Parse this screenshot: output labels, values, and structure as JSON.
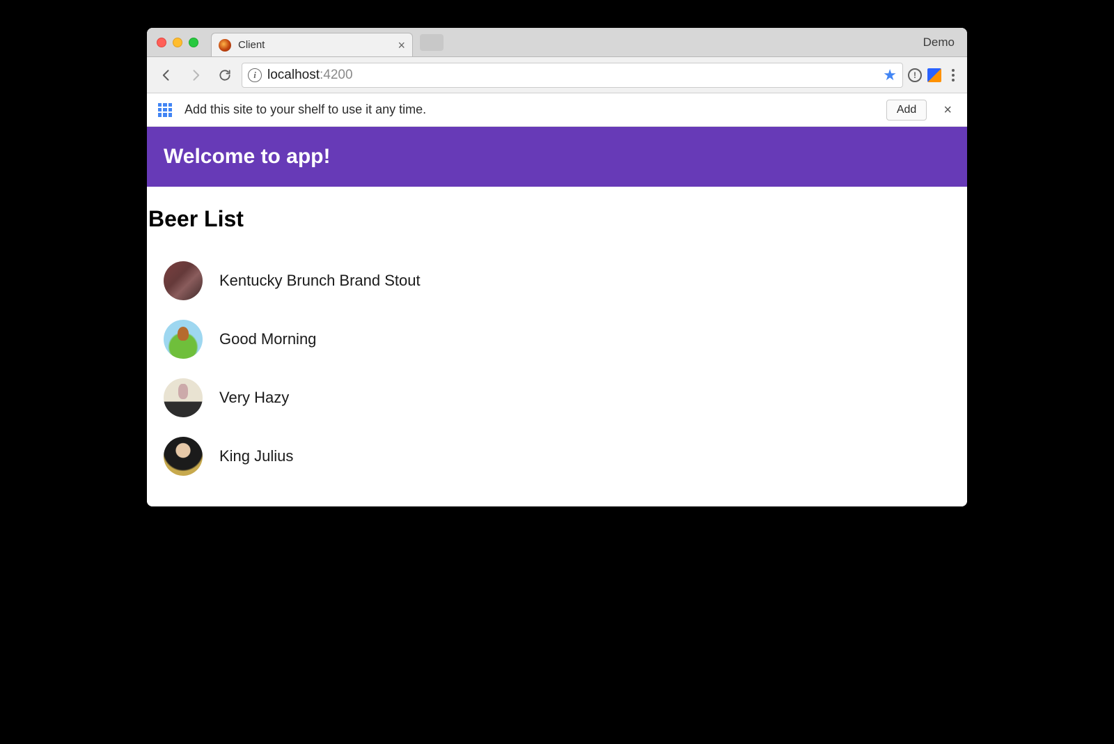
{
  "browser": {
    "tab_title": "Client",
    "profile_label": "Demo",
    "url_host": "localhost",
    "url_port": ":4200"
  },
  "infobar": {
    "message": "Add this site to your shelf to use it any time.",
    "add_label": "Add"
  },
  "app": {
    "header_title": "Welcome to app!",
    "list_heading": "Beer List",
    "beers": [
      {
        "name": "Kentucky Brunch Brand Stout"
      },
      {
        "name": "Good Morning"
      },
      {
        "name": "Very Hazy"
      },
      {
        "name": "King Julius"
      }
    ]
  },
  "colors": {
    "brand_purple": "#673ab7",
    "chrome_star_blue": "#4285f4"
  }
}
